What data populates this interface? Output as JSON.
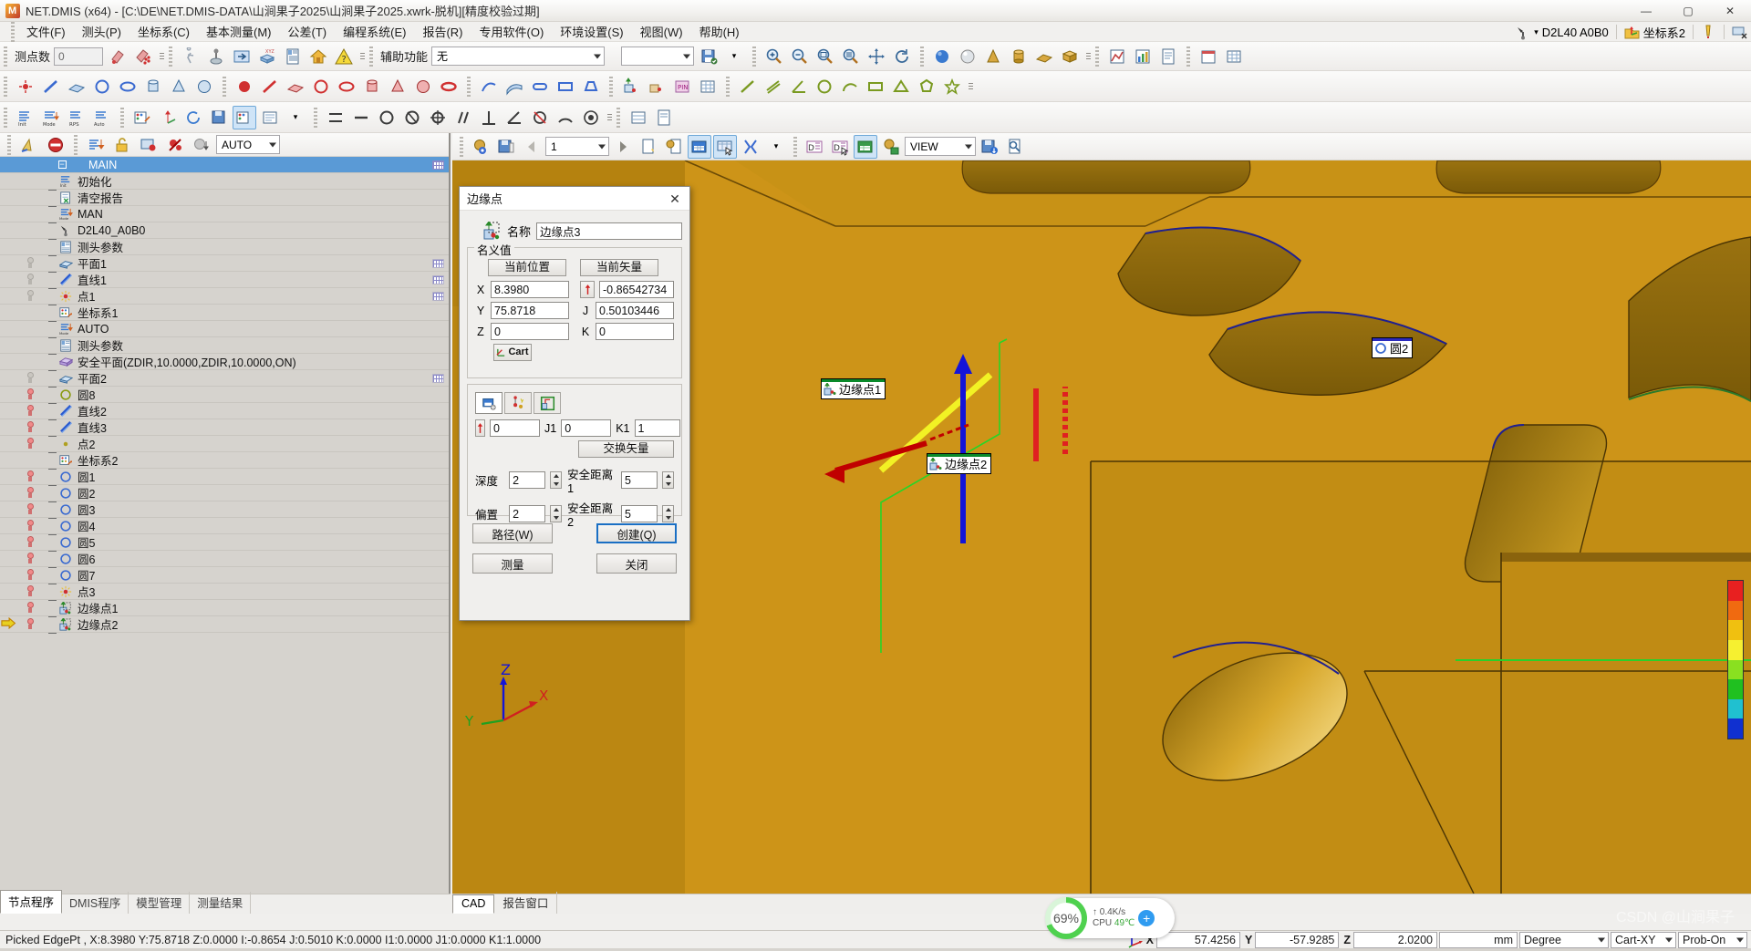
{
  "window": {
    "title": "NET.DMIS (x64) - [C:\\DE\\NET.DMIS-DATA\\山涧果子2025\\山涧果子2025.xwrk-脱机][精度校验过期]",
    "minimize": "—",
    "maximize": "▢",
    "close": "✕"
  },
  "menu": {
    "items": [
      {
        "label": "文件(F)"
      },
      {
        "label": "测头(P)"
      },
      {
        "label": "坐标系(C)"
      },
      {
        "label": "基本测量(M)"
      },
      {
        "label": "公差(T)"
      },
      {
        "label": "编程系统(E)"
      },
      {
        "label": "报告(R)"
      },
      {
        "label": "专用软件(O)"
      },
      {
        "label": "环境设置(S)"
      },
      {
        "label": "视图(W)"
      },
      {
        "label": "帮助(H)"
      }
    ]
  },
  "header_right": {
    "probe_name": "D2L40  A0B0",
    "csys_name": "坐标系2"
  },
  "toolbar1": {
    "point_count_label": "测点数",
    "point_count_value": "0",
    "aux_label": "辅助功能",
    "aux_value": "无",
    "view_combo_value": ""
  },
  "left_toolbar": {
    "mode_value": "AUTO"
  },
  "cad_toolbar": {
    "page_value": "1",
    "view_combo_value": "VIEW"
  },
  "tree": {
    "rows": [
      {
        "label": "MAIN",
        "icon": "main-icon",
        "bulb": "none",
        "badge": "grid",
        "selected": true,
        "root": true
      },
      {
        "label": "初始化",
        "icon": "init-icon",
        "bulb": "none",
        "badge": "none"
      },
      {
        "label": "清空报告",
        "icon": "clear-report-icon",
        "bulb": "none",
        "badge": "none"
      },
      {
        "label": "MAN",
        "icon": "mode-icon",
        "bulb": "none",
        "badge": "none"
      },
      {
        "label": "D2L40_A0B0",
        "icon": "probe-icon",
        "bulb": "none",
        "badge": "none"
      },
      {
        "label": "测头参数",
        "icon": "params-icon",
        "bulb": "none",
        "badge": "none"
      },
      {
        "label": "平面1",
        "icon": "plane-icon",
        "bulb": "off",
        "badge": "grid-lite"
      },
      {
        "label": "直线1",
        "icon": "line-icon",
        "bulb": "off",
        "badge": "grid-lite"
      },
      {
        "label": "点1",
        "icon": "point-icon",
        "bulb": "off",
        "badge": "grid-lite"
      },
      {
        "label": "坐标系1",
        "icon": "csys-icon",
        "bulb": "none",
        "badge": "none"
      },
      {
        "label": "AUTO",
        "icon": "mode-icon",
        "bulb": "none",
        "badge": "none"
      },
      {
        "label": "测头参数",
        "icon": "params-icon",
        "bulb": "none",
        "badge": "none"
      },
      {
        "label": "安全平面(ZDIR,10.0000,ZDIR,10.0000,ON)",
        "icon": "safeplane-icon",
        "bulb": "none",
        "badge": "none"
      },
      {
        "label": "平面2",
        "icon": "plane-icon",
        "bulb": "off",
        "badge": "grid-lite"
      },
      {
        "label": "圆8",
        "icon": "circle-olive-icon",
        "bulb": "on",
        "badge": "none"
      },
      {
        "label": "直线2",
        "icon": "line-icon",
        "bulb": "on",
        "badge": "none"
      },
      {
        "label": "直线3",
        "icon": "line-icon",
        "bulb": "on",
        "badge": "none"
      },
      {
        "label": "点2",
        "icon": "point-dot-icon",
        "bulb": "on",
        "badge": "none"
      },
      {
        "label": "坐标系2",
        "icon": "csys-icon",
        "bulb": "none",
        "badge": "none"
      },
      {
        "label": "圆1",
        "icon": "circle-icon",
        "bulb": "on",
        "badge": "none"
      },
      {
        "label": "圆2",
        "icon": "circle-icon",
        "bulb": "on",
        "badge": "none"
      },
      {
        "label": "圆3",
        "icon": "circle-icon",
        "bulb": "on",
        "badge": "none"
      },
      {
        "label": "圆4",
        "icon": "circle-icon",
        "bulb": "on",
        "badge": "none"
      },
      {
        "label": "圆5",
        "icon": "circle-icon",
        "bulb": "on",
        "badge": "none"
      },
      {
        "label": "圆6",
        "icon": "circle-icon",
        "bulb": "on",
        "badge": "none"
      },
      {
        "label": "圆7",
        "icon": "circle-icon",
        "bulb": "on",
        "badge": "none"
      },
      {
        "label": "点3",
        "icon": "point-icon",
        "bulb": "on",
        "badge": "none"
      },
      {
        "label": "边缘点1",
        "icon": "edgept-icon",
        "bulb": "on",
        "badge": "none"
      },
      {
        "label": "边缘点2",
        "icon": "edgept-icon",
        "bulb": "on",
        "badge": "none",
        "cursor": true,
        "last": true
      }
    ]
  },
  "left_tabs": {
    "items": [
      {
        "label": "节点程序",
        "active": true
      },
      {
        "label": "DMIS程序",
        "active": false
      },
      {
        "label": "模型管理",
        "active": false
      },
      {
        "label": "测量结果",
        "active": false
      }
    ]
  },
  "cad_tabs": {
    "items": [
      {
        "label": "CAD",
        "active": true
      },
      {
        "label": "报告窗口",
        "active": false
      }
    ]
  },
  "cad_labels": {
    "edge1": "边缘点1",
    "edge2": "边缘点2",
    "circle2": "圆2",
    "axis_z": "Z",
    "axis_y": "Y",
    "axis_x": "X"
  },
  "dialog": {
    "title": "边缘点",
    "close": "✕",
    "name_label": "名称",
    "name_value": "边缘点3",
    "nominal_group_title": "名义值",
    "current_position_btn": "当前位置",
    "current_vector_btn": "当前矢量",
    "pos": {
      "x_label": "X",
      "x_value": "8.3980",
      "y_label": "Y",
      "y_value": "75.8718",
      "z_label": "Z",
      "z_value": "0"
    },
    "vec": {
      "i_label": "I",
      "i_value": "-0.86542734",
      "j_label": "J",
      "j_value": "0.50103446",
      "k_label": "K",
      "k_value": "0"
    },
    "cart_btn": "Cart",
    "tabs": [
      {
        "name": "auto-tab",
        "active": true
      },
      {
        "name": "point-tab",
        "active": false
      },
      {
        "name": "path-tab",
        "active": false
      }
    ],
    "vec2": {
      "i1_label": "I1",
      "i1_value": "0",
      "j1_label": "J1",
      "j1_value": "0",
      "k1_label": "K1",
      "k1_value": "1"
    },
    "swap_vector_btn": "交换矢量",
    "depth_label": "深度",
    "depth_value": "2",
    "safe1_label": "安全距离1",
    "safe1_value": "5",
    "offset_label": "偏置",
    "offset_value": "2",
    "safe2_label": "安全距离2",
    "safe2_value": "5",
    "path_btn": "路径(W)",
    "create_btn": "创建(Q)",
    "measure_btn": "测量",
    "close_btn": "关闭"
  },
  "statusbar": {
    "message": "Picked EdgePt , X:8.3980 Y:75.8718 Z:0.0000  I:-0.8654  J:0.5010  K:0.0000  I1:0.0000  J1:0.0000  K1:1.0000",
    "x_label": "X",
    "x_value": "57.4256",
    "y_label": "Y",
    "y_value": "-57.9285",
    "z_label": "Z",
    "z_value": "2.0200",
    "unit": "mm",
    "angle_unit": "Degree",
    "coord_mode": "Cart-XY",
    "probe_state": "Prob-On"
  },
  "cpu_widget": {
    "percent": "69%",
    "net_speed": "0.4K/s",
    "cpu_label": "CPU",
    "cpu_temp": "49℃",
    "plus": "+"
  },
  "watermark": "CSDN @山涧果子",
  "colors": {
    "accent_blue": "#1a6fc4",
    "selection_blue": "#5a9ad6",
    "cad_gold": "#c88e16",
    "cad_dark": "#8a6a12",
    "green_ring": "#4fd14f"
  }
}
